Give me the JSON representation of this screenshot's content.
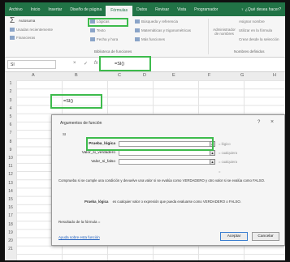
{
  "tabs": [
    "Archivo",
    "Inicio",
    "Insertar",
    "Diseño de página",
    "Fórmulas",
    "Datos",
    "Revisar",
    "Vista",
    "Programador",
    "♀ ¿Qué desea hacer?"
  ],
  "ribbon": {
    "autosum": "Autosuma",
    "recent": "Usadas recientemente",
    "financial": "Financieras",
    "logical": "Lógicas",
    "text": "Texto",
    "datetime": "Fecha y hora",
    "lookup": "Búsqueda y referencia",
    "math": "Matemáticas y trigonométricas",
    "more": "Más funciones",
    "name_manager": "Administrador de nombres",
    "assign_name": "Asignar nombre",
    "use_formula": "Utilizar en la fórmula",
    "create_from_sel": "Crear desde la selección",
    "group_library": "Biblioteca de funciones",
    "group_names": "Nombres definidos"
  },
  "formula_bar": {
    "name_box": "SI",
    "cancel": "×",
    "enter": "✓",
    "fx": "fx",
    "text": "=SI()"
  },
  "columns": [
    "A",
    "B",
    "C",
    "D",
    "E",
    "F",
    "G",
    "H"
  ],
  "rows": [
    "1",
    "2",
    "3",
    "4",
    "5",
    "6",
    "7",
    "8",
    "9",
    "10",
    "11",
    "12",
    "13",
    "14",
    "15",
    "16",
    "17",
    "18",
    "19",
    "20",
    "21"
  ],
  "active_cell_text": "=SI()",
  "dialog": {
    "title": "Argumentos de función",
    "help_q": "?",
    "close": "×",
    "function_name": "SI",
    "args": [
      {
        "label": "Prueba_lógica",
        "value": "= lógico"
      },
      {
        "label": "Valor_si_verdadero",
        "value": "= cualquiera"
      },
      {
        "label": "Valor_si_falso",
        "value": "= cualquiera"
      }
    ],
    "result_eq": "=",
    "description": "Comprueba si se cumple una condición y devuelve una valor si se evalúa como VERDADERO y otro valor si se evalúa como FALSO.",
    "arg_desc_label": "Prueba_lógica",
    "arg_desc_text": "es cualquier valor o expresión que pueda evaluarse como VERDADERO o FALSO.",
    "result_label": "Resultado de la fórmula =",
    "help_link": "Ayuda sobre esta función",
    "ok": "Aceptar",
    "cancel": "Cancelar"
  },
  "colors": {
    "accent": "#217346",
    "highlight": "#3dbb4c"
  }
}
